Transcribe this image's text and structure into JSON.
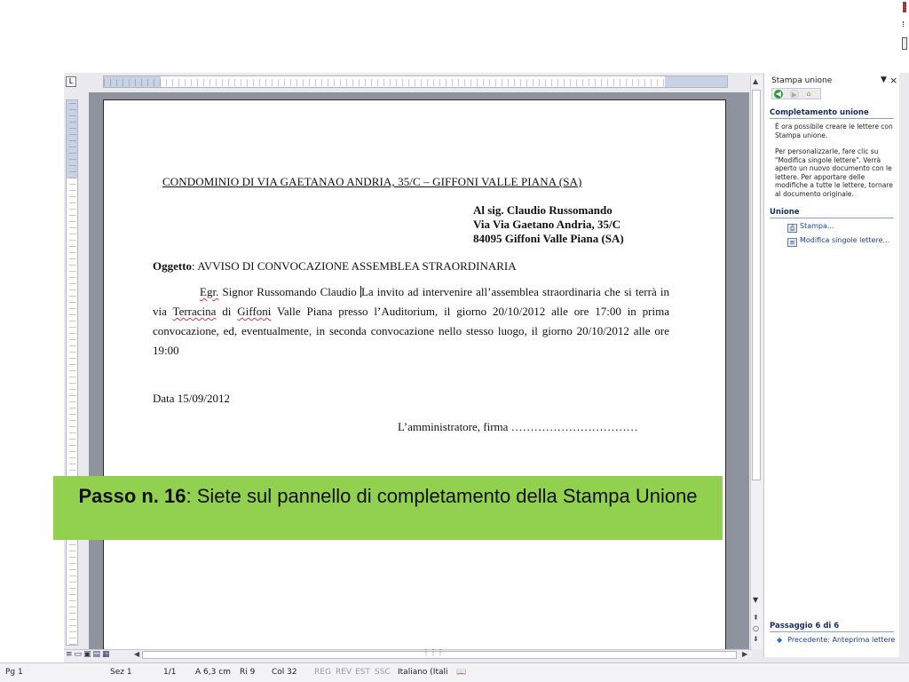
{
  "document": {
    "title": "CONDOMINIO DI VIA GAETANAO ANDRIA, 35/C – GIFFONI VALLE PIANA (SA)",
    "recipient": {
      "line1": "Al sig. Claudio Russomando",
      "line2": "Via Via Gaetano Andria, 35/C",
      "line3": "84095 Giffoni Valle Piana (SA)"
    },
    "subject_label": "Oggetto",
    "subject_text": ": AVVISO DI CONVOCAZIONE ASSEMBLEA STRAORDINARIA",
    "body": {
      "p1": "Egr.",
      "p2": " Signor Russomando Claudio ",
      "p3": "La invito ad intervenire all’assemblea straordinaria che si terrà in via ",
      "p4": "Terracina",
      "p5": " di ",
      "p6": "Giffoni",
      "p7": " Valle Piana presso l’Auditorium, il giorno 20/10/2012 alle ore 17:00 in prima convocazione, ed, eventualmente, in seconda convocazione nello stesso luogo, il giorno 20/10/2012 alle ore 19:00"
    },
    "date_line": "Data 15/09/2012",
    "signature": "L’amministratore, firma ……………………………"
  },
  "caption": {
    "bold": "Passo n. 16",
    "text": ": Siete sul pannello di completamento della Stampa Unione"
  },
  "task_pane": {
    "title": "Stampa unione",
    "close_label": "×",
    "section_completion": "Completamento unione",
    "completion_text1": "È ora possibile creare le lettere con Stampa unione.",
    "completion_text2": "Per personalizzarle, fare clic su \"Modifica singole lettere\". Verrà aperto un nuovo documento con le lettere. Per apportare delle modifiche a tutte le lettere, tornare al documento originale.",
    "section_merge": "Unione",
    "link_print": "Stampa...",
    "link_edit": "Modifica singole lettere...",
    "step": "Passaggio 6 di 6",
    "previous": "Precedente: Anteprima lettere"
  },
  "status_bar": {
    "page": "Pg 1",
    "section": "Sez 1",
    "pages": "1/1",
    "at": "A 6,3 cm",
    "line": "Ri 9",
    "column": "Col 32",
    "rec": "REG",
    "rev": "REV",
    "ext": "EST",
    "ovr": "SSC",
    "language": "Italiano (Itali"
  },
  "ruler_corner_label": "L",
  "colors": {
    "caption_bg": "#92d050",
    "link": "#1f3d99",
    "section_heading": "#1b2b5c"
  }
}
